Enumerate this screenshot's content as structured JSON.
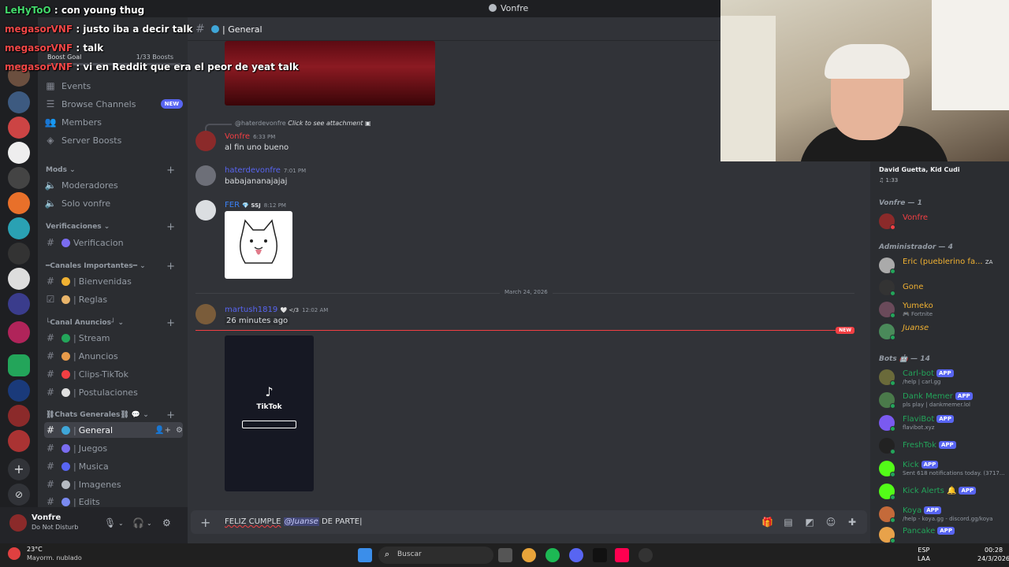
{
  "window": {
    "title": "Vonfre"
  },
  "stream_overlay": [
    {
      "user": "LeHyToO",
      "text": "con young thug"
    },
    {
      "user": "megasorVNF",
      "text": "justo iba a decir talk"
    },
    {
      "user": "megasorVNF",
      "text": "talk"
    },
    {
      "user": "megasorVNF",
      "text": "vi en Reddit que era el peor de yeat talk"
    }
  ],
  "boost_goal": {
    "label": "Boost Goal",
    "count": "1/33 Boosts"
  },
  "sidebar": {
    "top_items": [
      {
        "icon": "calendar-icon",
        "label": "Events"
      },
      {
        "icon": "browse-icon",
        "label": "Browse Channels",
        "badge": "NEW"
      },
      {
        "icon": "members-icon",
        "label": "Members"
      },
      {
        "icon": "boost-icon",
        "label": "Server Boosts"
      }
    ],
    "categories": [
      {
        "name": "Mods",
        "channels": [
          {
            "label": "Moderadores",
            "type": "voice"
          },
          {
            "label": "Solo vonfre",
            "type": "voice"
          }
        ]
      },
      {
        "name": "Verificaciones",
        "channels": [
          {
            "label": "Verificacion",
            "type": "text"
          }
        ]
      },
      {
        "name": "━Canales Importantes━",
        "channels": [
          {
            "label": "Bienvenidas",
            "type": "text"
          },
          {
            "label": "Reglas",
            "type": "rules"
          }
        ]
      },
      {
        "name": "└Canal Anuncios┘",
        "channels": [
          {
            "label": "Stream",
            "type": "text"
          },
          {
            "label": "Anuncios",
            "type": "text"
          },
          {
            "label": "Clips-TikTok",
            "type": "text"
          },
          {
            "label": "Postulaciones",
            "type": "text"
          }
        ]
      },
      {
        "name": "⛓Chats Generales⛓",
        "channels": [
          {
            "label": "General",
            "type": "text",
            "active": true
          },
          {
            "label": "Juegos",
            "type": "text"
          },
          {
            "label": "Musica",
            "type": "text"
          },
          {
            "label": "Imagenes",
            "type": "text"
          },
          {
            "label": "Edits",
            "type": "text"
          }
        ]
      }
    ]
  },
  "user_panel": {
    "name": "Vonfre",
    "status": "Do Not Disturb"
  },
  "channel": {
    "name": "General"
  },
  "messages": {
    "reply_preview": {
      "user": "@haterdevonfre",
      "text": "Click to see attachment"
    },
    "m1": {
      "author": "Vonfre",
      "time": "6:33 PM",
      "text": "al fin uno bueno",
      "color": "#f23f43"
    },
    "m2": {
      "author": "haterdevonfre",
      "time": "7:01 PM",
      "text": "babajananajajaj",
      "color": "#5865f2"
    },
    "m3": {
      "author": "FER",
      "tag": "SSJ",
      "time": "8:12 PM",
      "color": "#3b82f6"
    },
    "date_divider": "March 24, 2026",
    "m4": {
      "author": "martush1819",
      "tag": "</3",
      "time": "12:02 AM",
      "text": "26 minutes ago",
      "color": "#5865f2"
    },
    "new_label": "NEW",
    "tiktok_label": "TikTok"
  },
  "composer": {
    "before": "FELIZ CUMPLE",
    "mention": "@Juanse",
    "after": "DE PARTE"
  },
  "members": {
    "activity": {
      "title": "David Guetta, Kid Cudi",
      "time": "1:33"
    },
    "groups": [
      {
        "label": "Vonfre — 1",
        "items": [
          {
            "name": "Vonfre",
            "color": "#f23f43"
          }
        ]
      },
      {
        "label": "Administrador — 4",
        "items": [
          {
            "name": "Eric (pueblerino fa...",
            "color": "#f0b132",
            "tag": "ZA"
          },
          {
            "name": "Gone",
            "color": "#f0b132"
          },
          {
            "name": "Yumeko",
            "color": "#f0b132",
            "sub": "Fortnite"
          },
          {
            "name": "Juanse",
            "color": "#f0b132"
          }
        ]
      },
      {
        "label": "Bots 🤖 — 14",
        "items": [
          {
            "name": "Carl-bot",
            "color": "#23a55a",
            "app": "APP",
            "sub": "/help | carl.gg"
          },
          {
            "name": "Dank Memer",
            "color": "#23a55a",
            "app": "APP",
            "sub": "pls play | dankmemer.lol"
          },
          {
            "name": "FlaviBot",
            "color": "#23a55a",
            "app": "APP",
            "sub": "flavibot.xyz"
          },
          {
            "name": "FreshTok",
            "color": "#23a55a",
            "app": "APP"
          },
          {
            "name": "Kick",
            "color": "#23a55a",
            "app": "APP",
            "sub": "Sent 618 notifications today. (3717..."
          },
          {
            "name": "Kick Alerts",
            "color": "#23a55a",
            "app": "APP"
          },
          {
            "name": "Koya",
            "color": "#23a55a",
            "app": "APP",
            "sub": "/help - koya.gg - discord.gg/koya"
          },
          {
            "name": "Pancake",
            "color": "#23a55a",
            "app": "APP"
          }
        ]
      }
    ]
  },
  "taskbar": {
    "weather": {
      "temp": "23°C",
      "desc": "Mayorm. nublado"
    },
    "search_placeholder": "Buscar",
    "lang": "ESP",
    "layout": "LAA",
    "time": "00:28",
    "date": "24/3/2026"
  }
}
